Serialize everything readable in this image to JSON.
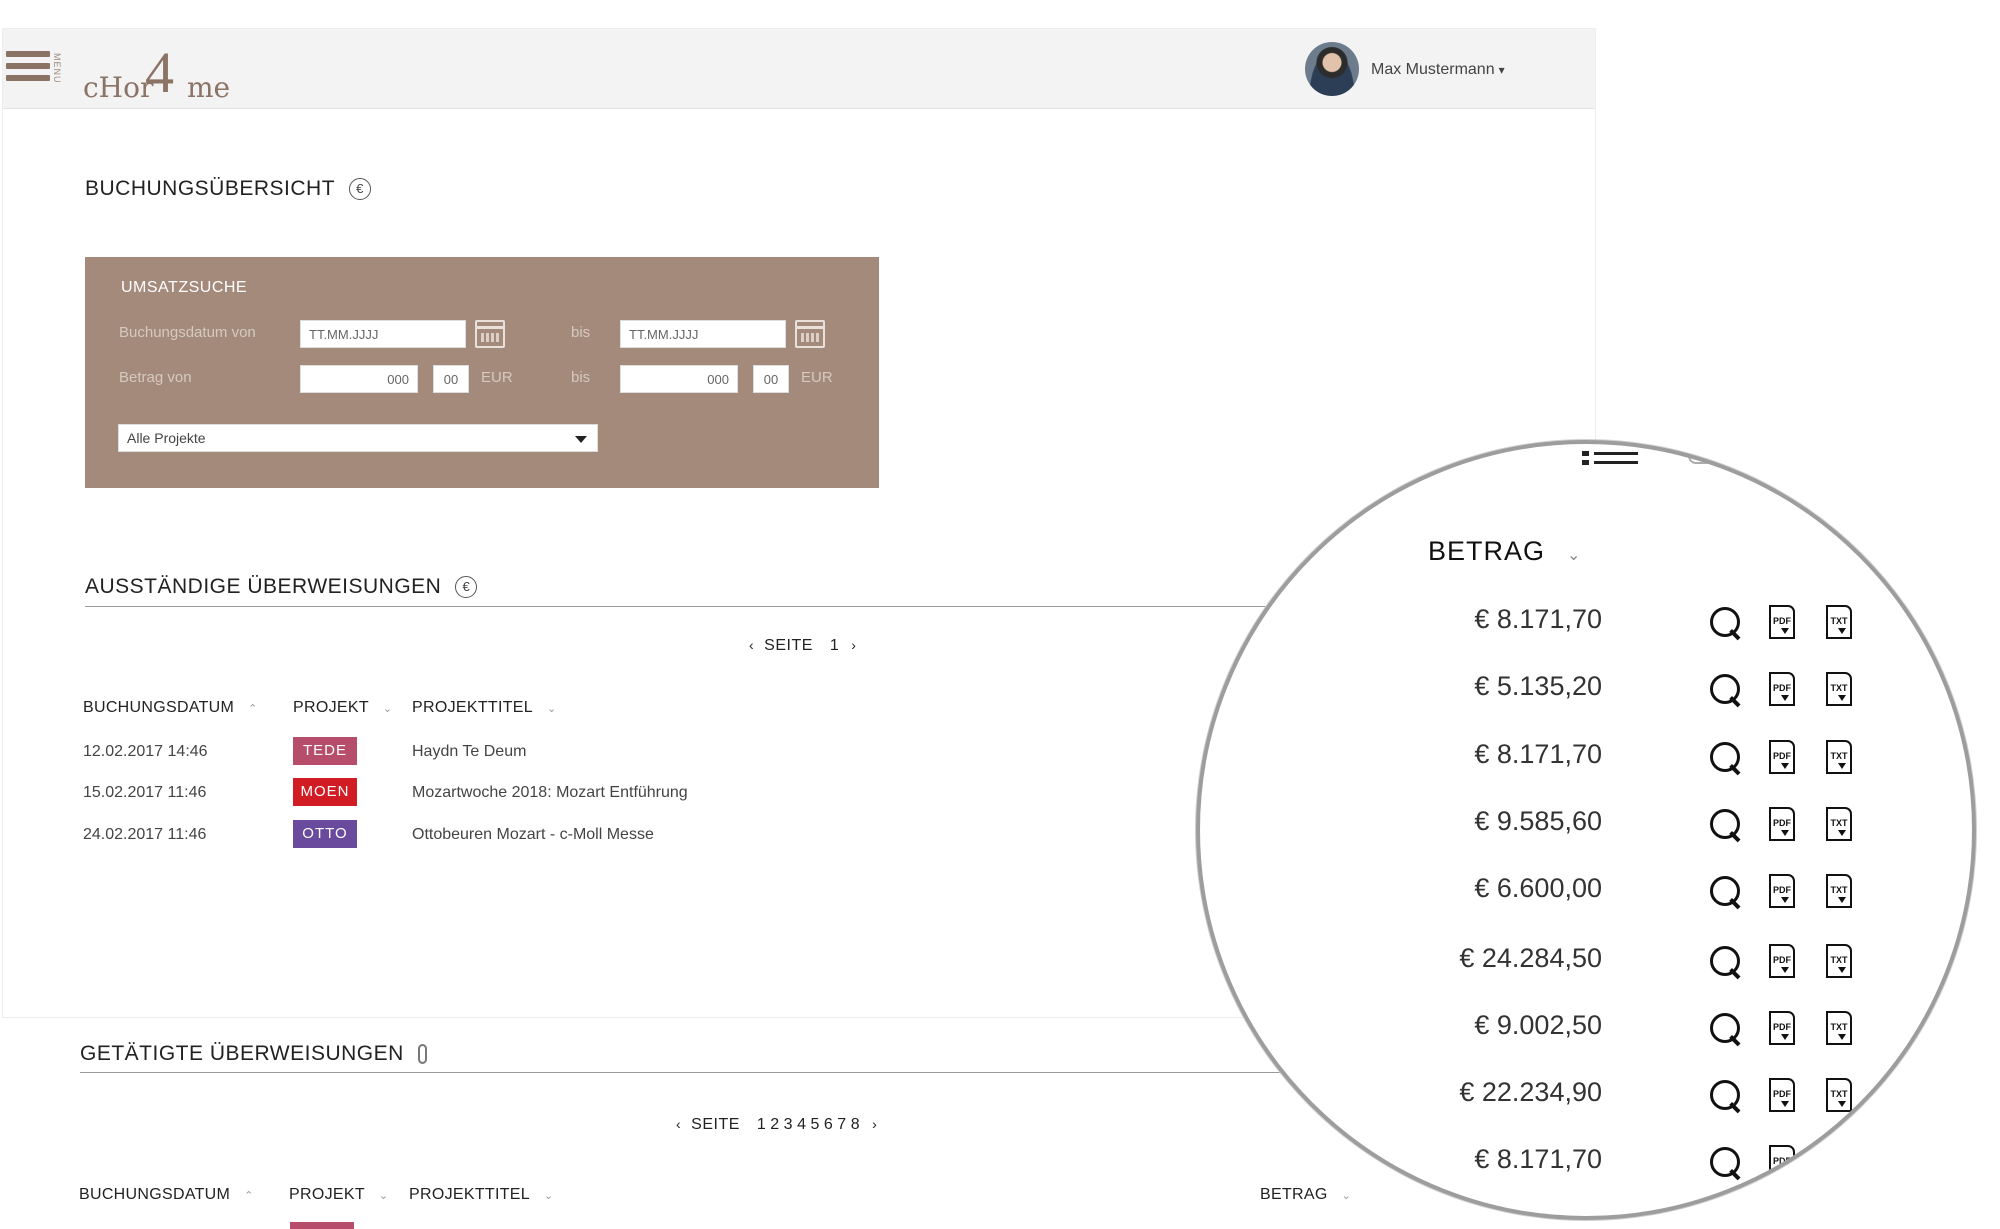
{
  "header": {
    "menu_label": "MENU",
    "logo_part1": "cHor",
    "logo_part2": "4",
    "logo_part3": "me",
    "user_name": "Max Mustermann",
    "user_caret": "▾"
  },
  "overview": {
    "title": "BUCHUNGSÜBERSICHT",
    "icon_glyph": "€"
  },
  "search": {
    "title": "UMSATZSUCHE",
    "date_from_label": "Buchungsdatum von",
    "date_from_placeholder": "TT.MM.JJJJ",
    "date_to_label": "bis",
    "date_to_placeholder": "TT.MM.JJJJ",
    "amount_from_label": "Betrag von",
    "amount_from_int": "000",
    "amount_from_dec": "00",
    "amount_from_currency": "EUR",
    "amount_to_label": "bis",
    "amount_to_int": "000",
    "amount_to_dec": "00",
    "amount_to_currency": "EUR",
    "project_select": "Alle Projekte"
  },
  "outstanding": {
    "title": "AUSSTÄNDIGE ÜBERWEISUNGEN",
    "icon_glyph": "€",
    "pager_label": "SEITE",
    "pages": [
      "1"
    ],
    "columns": [
      "BUCHUNGSDATUM",
      "PROJEKT",
      "PROJEKTTITEL"
    ],
    "sort_glyphs": [
      "⌃",
      "⌄",
      "⌄"
    ],
    "rows": [
      {
        "date": "12.02.2017 14:46",
        "tag": "TEDE",
        "title": "Haydn Te Deum",
        "color": "#b64d6b"
      },
      {
        "date": "15.02.2017 11:46",
        "tag": "MOEN",
        "title": "Mozartwoche 2018: Mozart Entführung",
        "color": "#d21c24"
      },
      {
        "date": "24.02.2017 11:46",
        "tag": "OTTO",
        "title": "Ottobeuren Mozart - c-Moll Messe",
        "color": "#6a4a9c"
      }
    ]
  },
  "completed": {
    "title": "GETÄTIGTE ÜBERWEISUNGEN",
    "pager_label": "SEITE",
    "pages": [
      "1",
      "2",
      "3",
      "4",
      "5",
      "6",
      "7",
      "8"
    ],
    "columns": [
      "BUCHUNGSDATUM",
      "PROJEKT",
      "PROJEKTTITEL",
      "BETRAG"
    ],
    "sort_glyphs": [
      "⌃",
      "⌄",
      "⌄",
      "⌄"
    ]
  },
  "magnifier": {
    "column_title": "BETRAG",
    "sort_glyph": "⌄",
    "amounts": [
      "€ 8.171,70",
      "€ 5.135,20",
      "€ 8.171,70",
      "€ 9.585,60",
      "€ 6.600,00",
      "€ 24.284,50",
      "€ 9.002,50",
      "€ 22.234,90",
      "€ 8.171,70"
    ],
    "pdf_label": "PDF",
    "txt_label": "TXT"
  },
  "chevron_left": "‹",
  "chevron_right": "›"
}
